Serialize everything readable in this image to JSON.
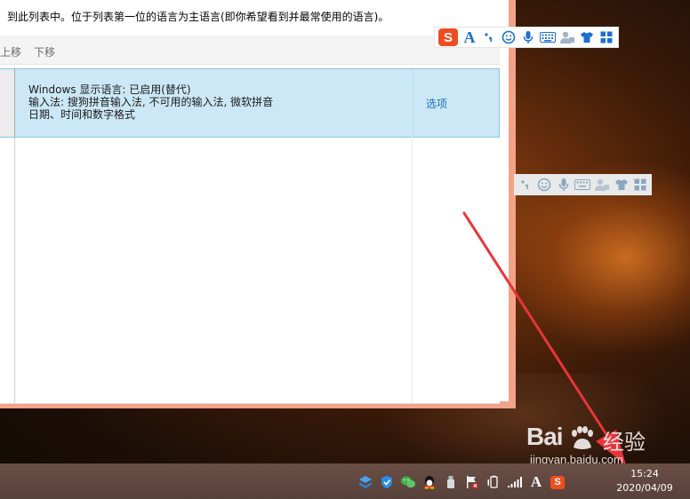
{
  "window": {
    "description": "到此列表中。位于列表第一位的语言为主语言(即你希望看到并最常使用的语言)。",
    "toolbar": {
      "move_up": "上移",
      "move_down": "下移"
    },
    "language_row": {
      "line1": "Windows 显示语言: 已启用(替代)",
      "line2": "输入法: 搜狗拼音输入法, 不可用的输入法, 微软拼音",
      "line3": "日期、时间和数字格式",
      "options_link": "选项"
    }
  },
  "ime_bar": {
    "logo": "S",
    "letter": "A",
    "items": [
      "punctuation-icon",
      "emoji-icon",
      "microphone-icon",
      "keyboard-icon",
      "user-icon",
      "skin-shirt-icon",
      "toolbox-grid-icon"
    ]
  },
  "watermark": {
    "brand": "Bai",
    "suffix": "经验",
    "url": "jingyan.baidu.com"
  },
  "taskbar": {
    "ime_letter": "A",
    "time": "15:24",
    "date": "2020/04/09"
  },
  "colors": {
    "window_border": "#f3a38a",
    "row_highlight": "#cce8f6",
    "link": "#1a6fc2",
    "sogou": "#ee4d21",
    "arrow": "#e8353b"
  }
}
